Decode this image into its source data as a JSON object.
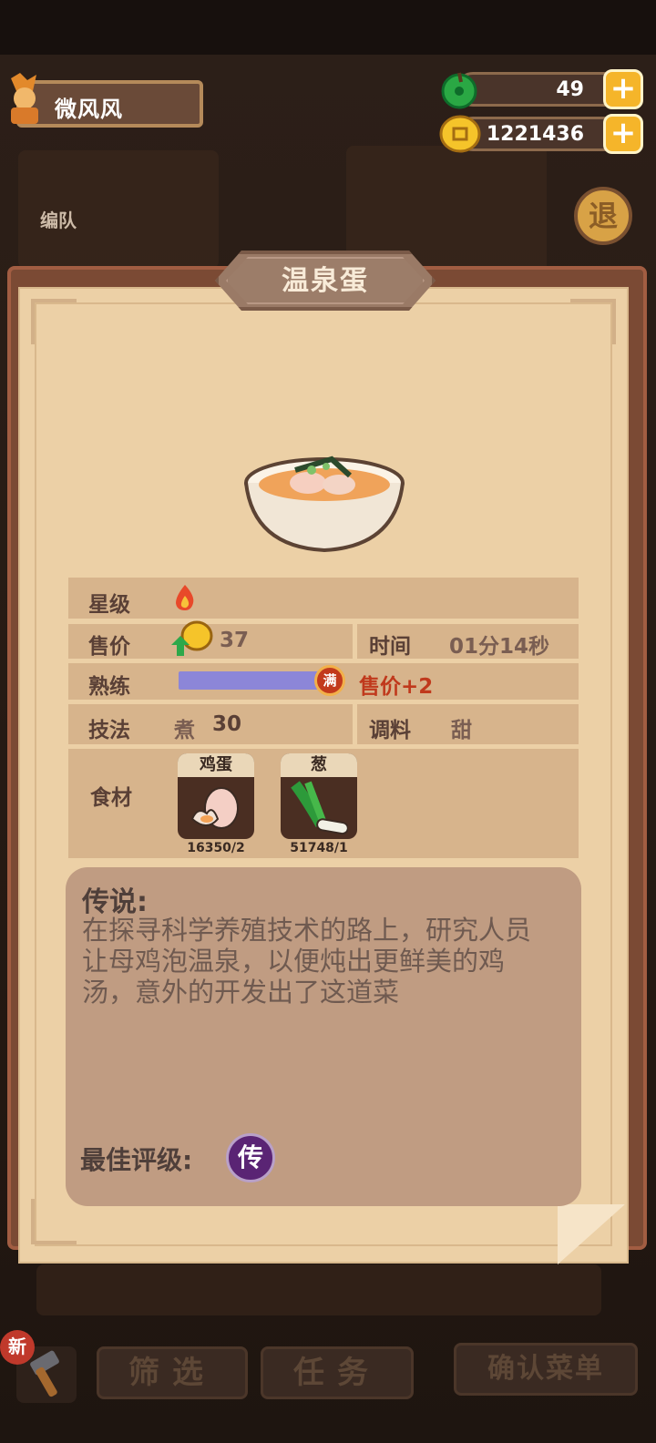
{
  "player": {
    "name": "微风风"
  },
  "resources": {
    "jade": "49",
    "coins": "1221436"
  },
  "background": {
    "team_label": "编队",
    "exit_label": "退"
  },
  "dish": {
    "title": "温泉蛋",
    "stats": {
      "star_label": "星级",
      "price_label": "售价",
      "price_value": "37",
      "time_label": "时间",
      "time_value": "01分14秒",
      "mastery_label": "熟练",
      "mastery_badge": "满",
      "mastery_bonus": "售价+2",
      "mastery_progress": 1.0,
      "technique_label": "技法",
      "technique_value": "煮",
      "technique_level": "30",
      "seasoning_label": "调料",
      "seasoning_value": "甜",
      "ingredients_label": "食材"
    },
    "ingredients": [
      {
        "name": "鸡蛋",
        "count": "16350/2",
        "icon": "egg-icon"
      },
      {
        "name": "葱",
        "count": "51748/1",
        "icon": "scallion-icon"
      }
    ],
    "legend": {
      "title": "传说:",
      "text": "在探寻科学养殖技术的路上，研究人员让母鸡泡温泉，以便炖出更鲜美的鸡汤，意外的开发出了这道菜",
      "best_rating_label": "最佳评级:",
      "best_rating_badge": "传"
    }
  },
  "bottom": {
    "new_badge": "新",
    "filter_label": "筛选",
    "task_label": "任务",
    "confirm_label": "确认菜单"
  },
  "colors": {
    "accent_gold": "#f5b52a",
    "paper": "#ecd0a6",
    "bonus_red": "#c0391c",
    "progress_purple": "#8c86d8"
  }
}
